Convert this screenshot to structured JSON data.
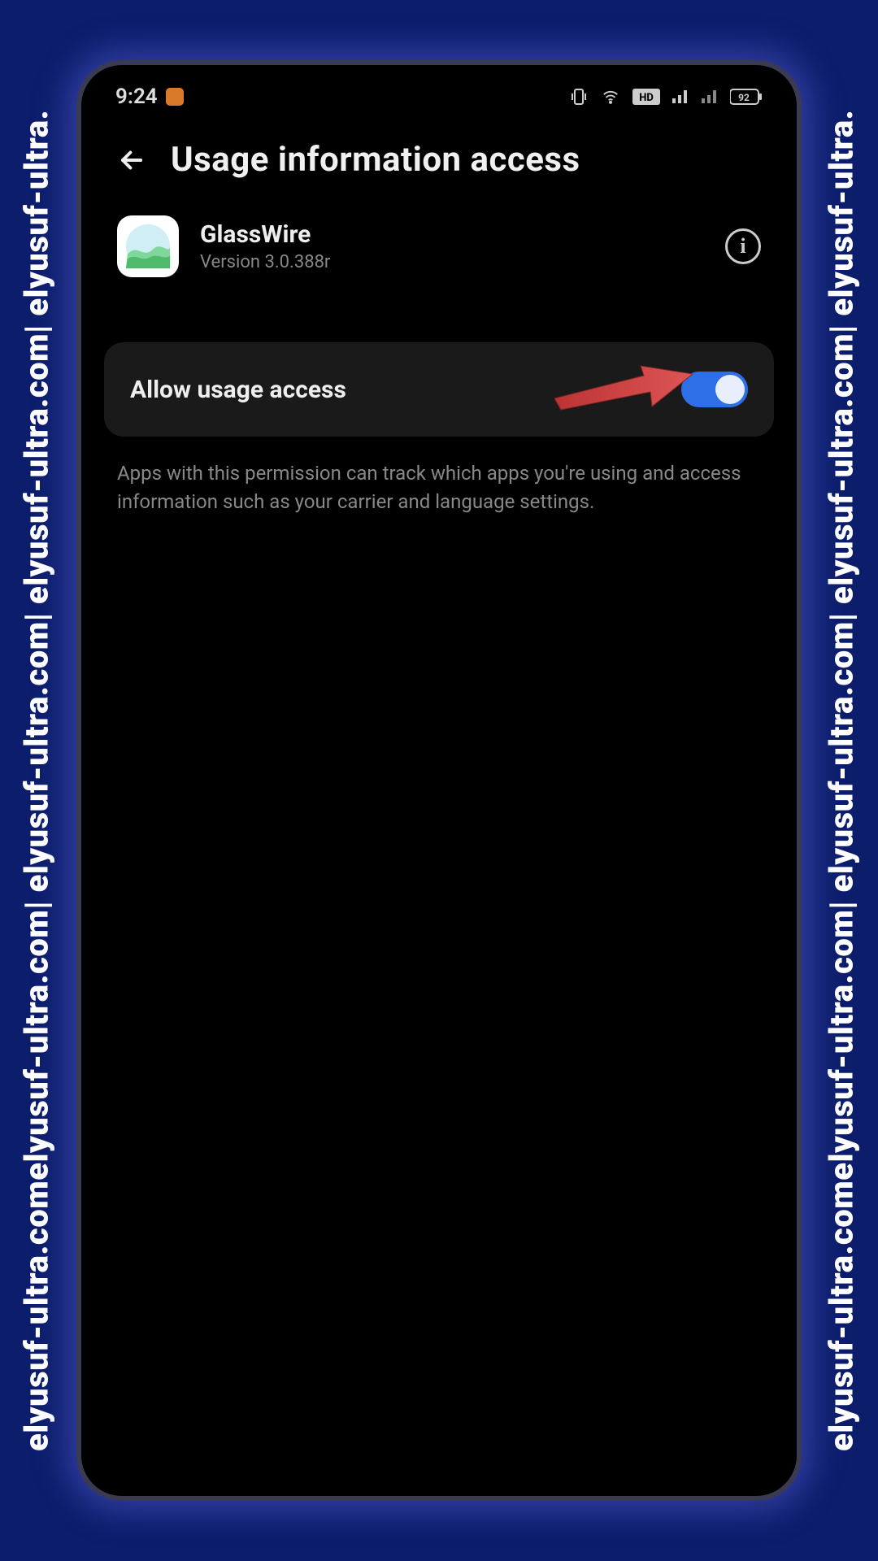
{
  "watermark": "elyusuf-ultra.comelyusuf-ultra.com| elyusuf-ultra.com| elyusuf-ultra.com| elyusuf-ultra.",
  "status": {
    "time": "9:24"
  },
  "header": {
    "title": "Usage information access"
  },
  "app": {
    "name": "GlassWire",
    "version": "Version 3.0.388r"
  },
  "setting": {
    "label": "Allow usage access",
    "enabled": true
  },
  "description": "Apps with this permission can track which apps you're using and access information such as your carrier and language settings."
}
